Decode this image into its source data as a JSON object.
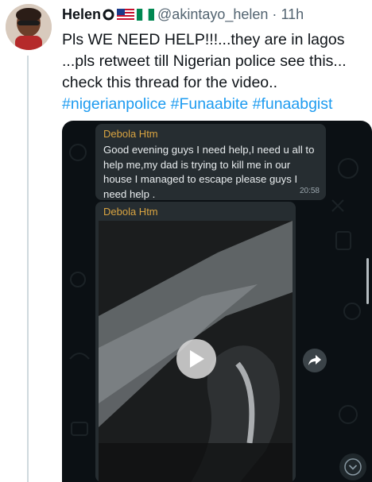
{
  "tweet": {
    "author_name": "Helen",
    "handle": "@akintayo_helen",
    "separator": "·",
    "time": "11h",
    "lines": [
      "Pls WE NEED HELP!!!...they are in lagos",
      "...pls retweet till Nigerian police see this...",
      "check this thread for the video.."
    ],
    "hashtags": "#nigerianpolice #Funaabite #funaabgist"
  },
  "chat": {
    "message1": {
      "sender": "Debola Htm",
      "lines": [
        "Good evening guys I need help,I need u all to",
        "help me,my dad is  trying to kill me in our",
        "house I managed to escape please guys I",
        "need help ."
      ],
      "time": "20:58"
    },
    "message2": {
      "sender": "Debola Htm"
    }
  },
  "icons": {
    "verified": "verified-badge-icon",
    "flag_us": "us-flag-icon",
    "flag_ng": "nigeria-flag-icon",
    "play": "play-icon",
    "share": "share-arrow-icon",
    "scroll_down": "chevron-down-icon"
  },
  "colors": {
    "hashtag": "#1d9bf0",
    "sender": "#d9a441",
    "bubble": "#262d31"
  }
}
